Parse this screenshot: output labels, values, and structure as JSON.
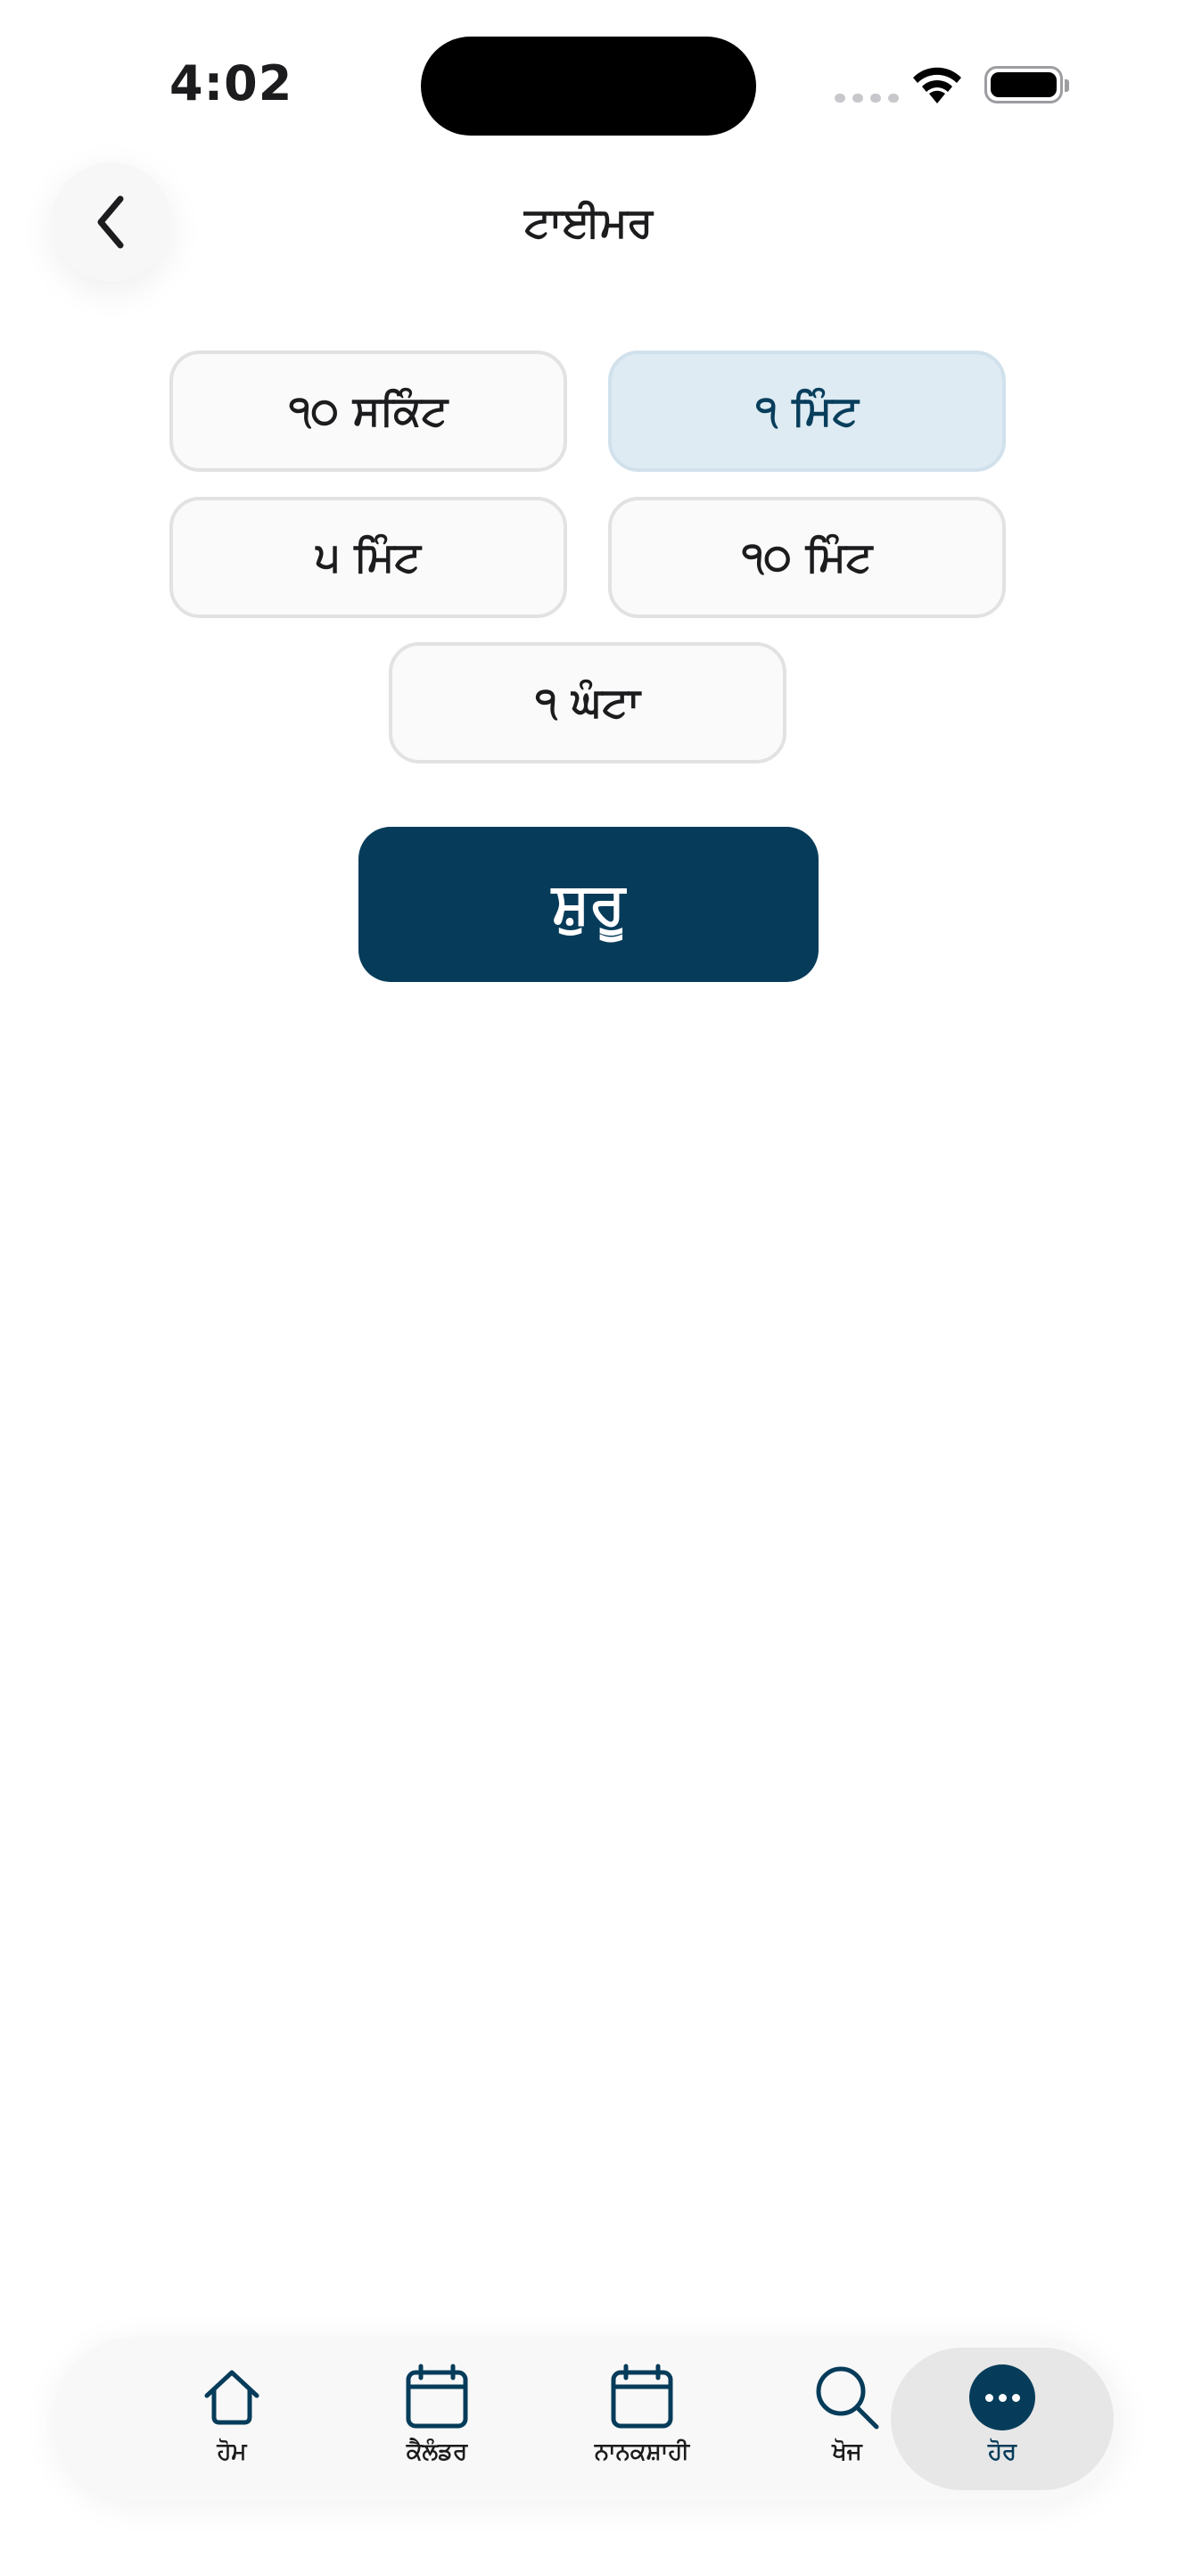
{
  "status_bar": {
    "time": "4:02"
  },
  "header": {
    "title": "ਟਾਈਮਰ"
  },
  "timer_options": [
    {
      "label": "੧੦ ਸਕਿੰਟ",
      "selected": false
    },
    {
      "label": "੧ ਮਿੰਟ",
      "selected": true
    },
    {
      "label": "੫ ਮਿੰਟ",
      "selected": false
    },
    {
      "label": "੧੦ ਮਿੰਟ",
      "selected": false
    },
    {
      "label": "੧ ਘੰਟਾ",
      "selected": false
    }
  ],
  "start_button": {
    "label": "ਸ਼ੁਰੂ"
  },
  "tab_bar": {
    "items": [
      {
        "label": "ਹੋਮ",
        "icon": "home-icon"
      },
      {
        "label": "ਕੈਲੰਡਰ",
        "icon": "calendar-icon"
      },
      {
        "label": "ਨਾਨਕਸ਼ਾਹੀ",
        "icon": "calendar-icon"
      },
      {
        "label": "ਖੋਜ",
        "icon": "search-icon"
      },
      {
        "label": "ਹੋਰ",
        "icon": "more-icon",
        "active": true
      }
    ]
  },
  "colors": {
    "accent": "#063c5a",
    "selected_bg": "#deebf3",
    "option_border": "#e2e2e2"
  }
}
